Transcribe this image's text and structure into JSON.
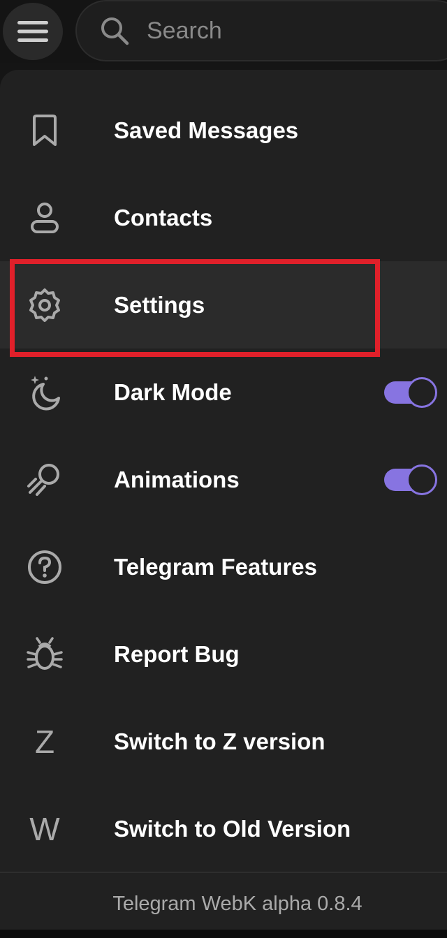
{
  "search": {
    "placeholder": "Search",
    "icon": "search-icon"
  },
  "header": {
    "menu_icon": "hamburger-menu-icon"
  },
  "menu": {
    "items": [
      {
        "label": "Saved Messages",
        "icon": "bookmark-icon"
      },
      {
        "label": "Contacts",
        "icon": "user-icon"
      },
      {
        "label": "Settings",
        "icon": "gear-icon",
        "active": true
      },
      {
        "label": "Dark Mode",
        "icon": "moon-icon",
        "toggle": true
      },
      {
        "label": "Animations",
        "icon": "animation-icon",
        "toggle": true
      },
      {
        "label": "Telegram Features",
        "icon": "question-icon"
      },
      {
        "label": "Report Bug",
        "icon": "bug-icon"
      },
      {
        "label": "Switch to Z version",
        "icon": "letter-z-icon",
        "glyph": "Z"
      },
      {
        "label": "Switch to Old Version",
        "icon": "letter-w-icon",
        "glyph": "W"
      }
    ]
  },
  "footer": {
    "version": "Telegram WebK alpha 0.8.4"
  },
  "colors": {
    "accent": "#8774e1",
    "highlight": "#e0202a",
    "menu_bg": "#212121",
    "active_bg": "#2b2b2b"
  }
}
